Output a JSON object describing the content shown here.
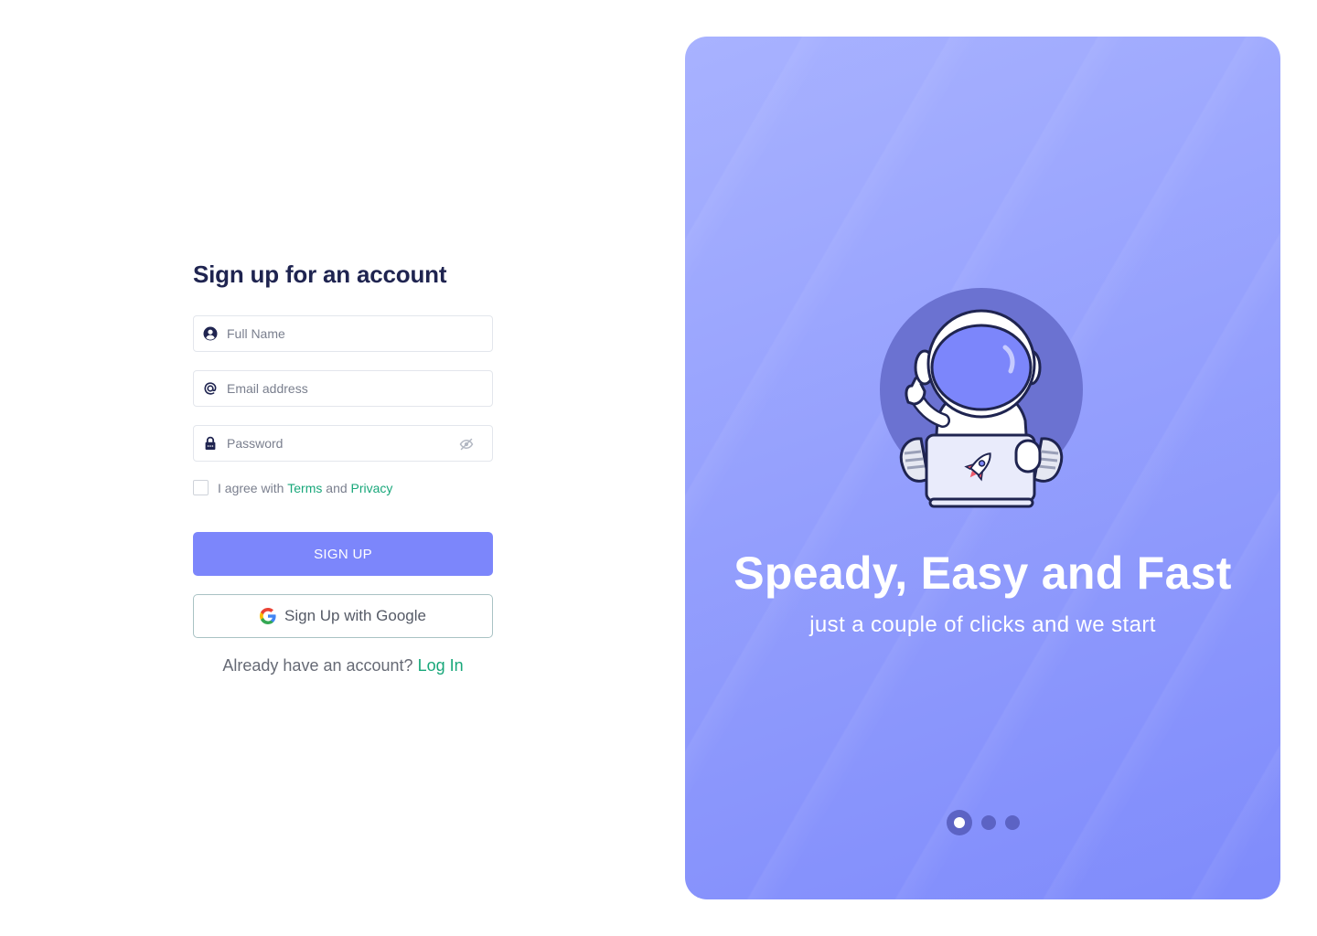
{
  "form": {
    "title": "Sign up for an account",
    "full_name_placeholder": "Full Name",
    "email_placeholder": "Email address",
    "password_placeholder": "Password",
    "agree_prefix": "I agree with",
    "terms_link": "Terms",
    "agree_and": "and",
    "privacy_link": "Privacy",
    "signup_label": "SIGN UP",
    "google_label": "Sign Up with Google",
    "login_prompt": "Already have an account?",
    "login_link": "Log In"
  },
  "icons": {
    "full_name": "user-icon",
    "email": "at-icon",
    "password": "lock-icon",
    "password_toggle": "eye-off-icon",
    "google": "google-logo-icon",
    "illustration": "astronaut-laptop-illustration"
  },
  "hero": {
    "headline": "Speady, Easy and Fast",
    "subtitle": "just a couple of clicks and we start",
    "carousel_slides": 3,
    "carousel_active_index": 0
  },
  "colors": {
    "primary": "#7c86fb",
    "link": "#18a77a",
    "title": "#1f2450",
    "panel_top": "#a8b2ff",
    "panel_bottom": "#7f8bfb"
  }
}
